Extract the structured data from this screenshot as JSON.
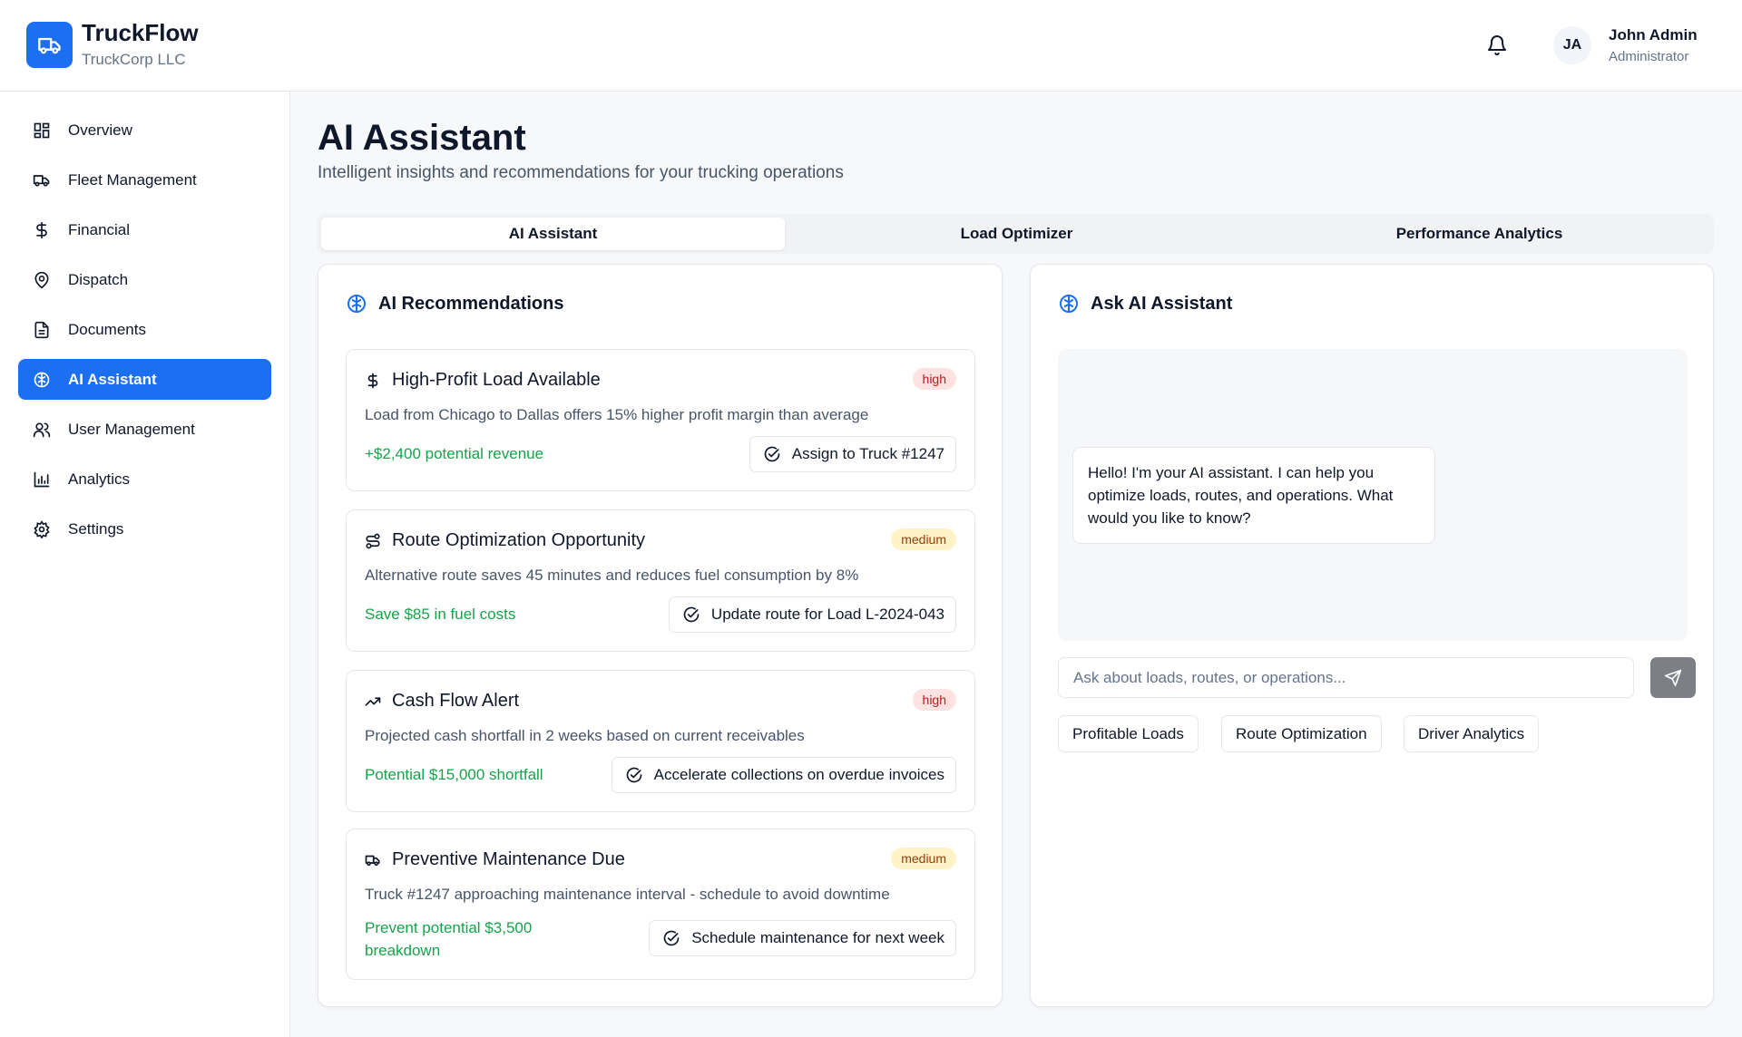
{
  "app": {
    "name": "TruckFlow",
    "company": "TruckCorp LLC"
  },
  "user": {
    "initials": "JA",
    "name": "John Admin",
    "role": "Administrator"
  },
  "sidebar": {
    "items": [
      {
        "label": "Overview",
        "icon": "grid-icon"
      },
      {
        "label": "Fleet Management",
        "icon": "truck-icon"
      },
      {
        "label": "Financial",
        "icon": "dollar-icon"
      },
      {
        "label": "Dispatch",
        "icon": "map-pin-icon"
      },
      {
        "label": "Documents",
        "icon": "document-icon"
      },
      {
        "label": "AI Assistant",
        "icon": "brain-icon",
        "active": true
      },
      {
        "label": "User Management",
        "icon": "users-icon"
      },
      {
        "label": "Analytics",
        "icon": "bar-chart-icon"
      },
      {
        "label": "Settings",
        "icon": "gear-icon"
      }
    ]
  },
  "page": {
    "title": "AI Assistant",
    "subtitle": "Intelligent insights and recommendations for your trucking operations"
  },
  "tabs": [
    {
      "label": "AI Assistant",
      "active": true
    },
    {
      "label": "Load Optimizer"
    },
    {
      "label": "Performance Analytics"
    }
  ],
  "recommendations": {
    "title": "AI Recommendations",
    "items": [
      {
        "icon": "dollar-icon",
        "title": "High-Profit Load Available",
        "priority": "high",
        "description": "Load from Chicago to Dallas offers 15% higher profit margin than average",
        "impact": "+$2,400 potential revenue",
        "action": "Assign to Truck #1247"
      },
      {
        "icon": "route-icon",
        "title": "Route Optimization Opportunity",
        "priority": "medium",
        "description": "Alternative route saves 45 minutes and reduces fuel consumption by 8%",
        "impact": "Save $85 in fuel costs",
        "action": "Update route for Load L-2024-043"
      },
      {
        "icon": "trending-up-icon",
        "title": "Cash Flow Alert",
        "priority": "high",
        "description": "Projected cash shortfall in 2 weeks based on current receivables",
        "impact": "Potential $15,000 shortfall",
        "action": "Accelerate collections on overdue invoices"
      },
      {
        "icon": "truck-icon",
        "title": "Preventive Maintenance Due",
        "priority": "medium",
        "description": "Truck #1247 approaching maintenance interval - schedule to avoid downtime",
        "impact_line1": "Prevent potential $3,500",
        "impact_line2": "breakdown",
        "action": "Schedule maintenance for next week"
      }
    ]
  },
  "chat": {
    "title": "Ask AI Assistant",
    "greeting": "Hello! I'm your AI assistant. I can help you optimize loads, routes, and operations. What would you like to know?",
    "placeholder": "Ask about loads, routes, or operations...",
    "suggestions": [
      "Profitable Loads",
      "Route Optimization",
      "Driver Analytics"
    ]
  },
  "colors": {
    "accent": "#1d6ff2",
    "success": "#16a34a",
    "high_bg": "#fee2e2",
    "medium_bg": "#fef3c7"
  }
}
